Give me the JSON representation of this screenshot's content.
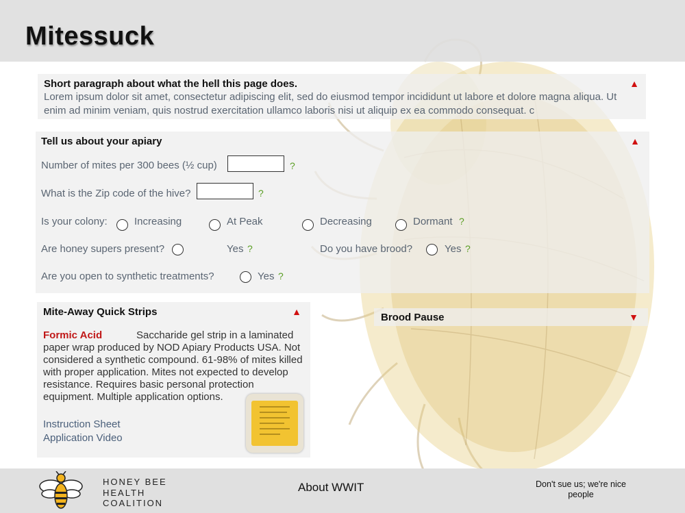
{
  "header": {
    "title": "Mitessuck"
  },
  "intro": {
    "title": "Short paragraph about what the hell this page does.",
    "body": "Lorem ipsum dolor sit amet, consectetur adipiscing elit, sed do eiusmod tempor incididunt ut labore et dolore magna aliqua. Ut enim ad minim veniam, quis nostrud exercitation ullamco laboris nisi ut aliquip ex ea commodo consequat. c",
    "toggle": "▲"
  },
  "apiary": {
    "title": "Tell us about your apiary",
    "toggle": "▲",
    "mites_label": "Number of mites per 300 bees (½ cup)",
    "mites_value": "",
    "zip_label": "What is the Zip code of the hive?",
    "zip_value": "",
    "colony_label": "Is your colony:",
    "colony_options": [
      "Increasing",
      "At Peak",
      "Decreasing",
      "Dormant"
    ],
    "supers_label": "Are honey supers present?",
    "supers_option": "Yes",
    "brood_label": "Do you have brood?",
    "brood_option": "Yes",
    "synthetic_label": "Are you open to synthetic treatments?",
    "synthetic_option": "Yes",
    "help": "?"
  },
  "treatment": {
    "title": "Mite-Away Quick Strips",
    "toggle": "▲",
    "type": "Formic Acid",
    "description": "Saccharide gel strip in a laminated paper wrap produced by NOD Apiary Products USA. Not considered a synthetic compound. 61-98% of mites killed with proper application. Mites not expected to develop resistance. Requires basic personal protection equipment. Multiple application options.",
    "links": [
      "Instruction Sheet",
      "Application Video"
    ]
  },
  "brood_pause": {
    "title": "Brood Pause",
    "toggle": "▼"
  },
  "footer": {
    "org_lines": [
      "HONEY BEE",
      "HEALTH",
      "COALITION"
    ],
    "about": "About WWIT",
    "disclaimer": "Don't sue us; we're nice people"
  },
  "colors": {
    "toggle": "#d01010",
    "help": "#5a9e24",
    "accent_red": "#c01818",
    "header_bg": "#dedede"
  }
}
